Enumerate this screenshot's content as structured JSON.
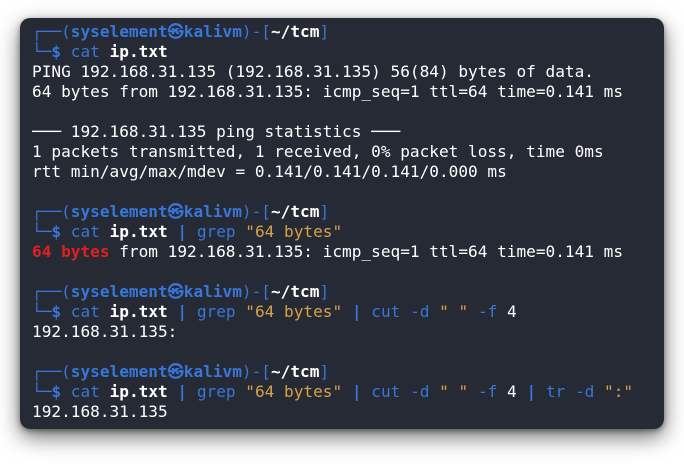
{
  "prompt": {
    "top_left": "┌──(",
    "user": "syselement",
    "at_symbol": "㉿",
    "host": "kalivm",
    "mid": ")-[",
    "path": "~/tcm",
    "close": "]",
    "bottom_left": "└─",
    "symbol": "$ "
  },
  "blocks": [
    {
      "command": {
        "cmd": "cat",
        "file": "ip.txt"
      },
      "output": [
        "PING 192.168.31.135 (192.168.31.135) 56(84) bytes of data.",
        "64 bytes from 192.168.31.135: icmp_seq=1 ttl=64 time=0.141 ms",
        "",
        "─── 192.168.31.135 ping statistics ───",
        "1 packets transmitted, 1 received, 0% packet loss, time 0ms",
        "rtt min/avg/max/mdev = 0.141/0.141/0.141/0.000 ms"
      ]
    },
    {
      "command": {
        "cmd": "cat",
        "file": "ip.txt",
        "pipe": "|",
        "cmd2": "grep",
        "pattern": "\"64 bytes\""
      },
      "output_match": "64 bytes",
      "output_rest": " from 192.168.31.135: icmp_seq=1 ttl=64 time=0.141 ms"
    },
    {
      "command": {
        "cmd": "cat",
        "file": "ip.txt",
        "pipe": "|",
        "cmd2": "grep",
        "pattern": "\"64 bytes\"",
        "cmd3": "cut",
        "opt_d": "-d",
        "delim": "\" \"",
        "opt_f": "-f",
        "field": "4"
      },
      "output": [
        "192.168.31.135:"
      ]
    },
    {
      "command": {
        "cmd": "cat",
        "file": "ip.txt",
        "pipe": "|",
        "cmd2": "grep",
        "pattern": "\"64 bytes\"",
        "cmd3": "cut",
        "opt_d": "-d",
        "delim": "\" \"",
        "opt_f": "-f",
        "field": "4",
        "cmd4": "tr",
        "delim2": "\":\""
      },
      "output": [
        "192.168.31.135"
      ]
    }
  ],
  "colors": {
    "background": "#252a35",
    "prompt_blue": "#3a76d6",
    "string_orange": "#d8a146",
    "match_red": "#e02020",
    "text_white": "#ffffff"
  }
}
